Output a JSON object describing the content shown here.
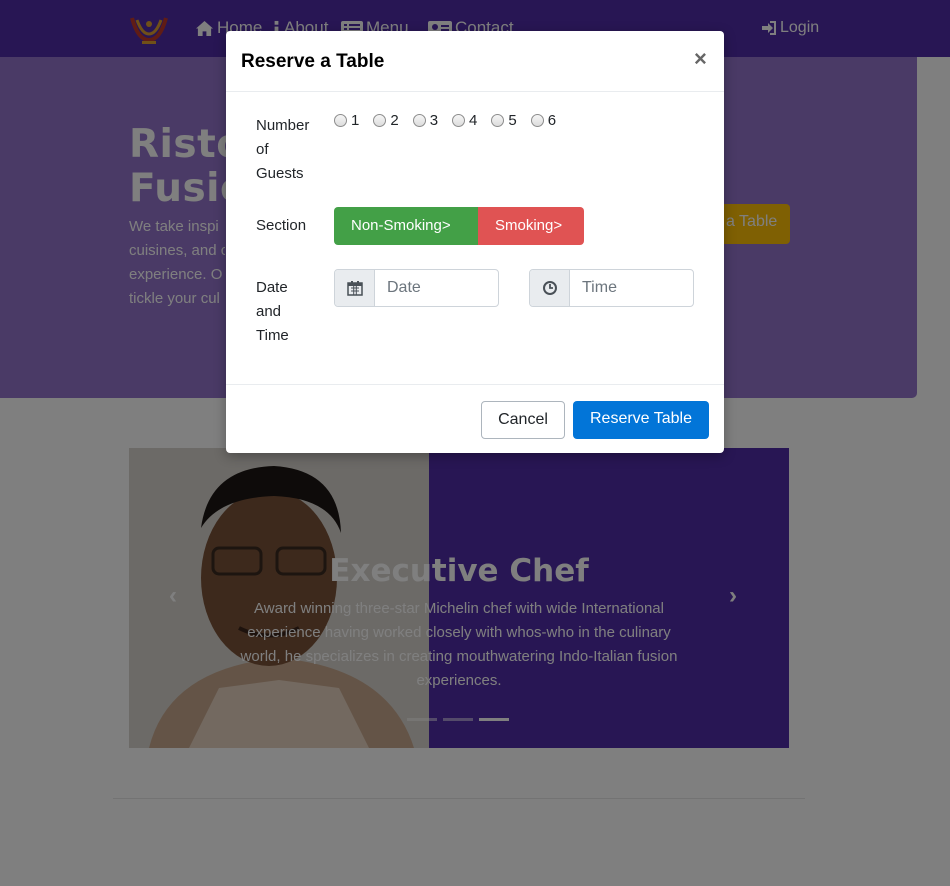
{
  "navbar": {
    "items": [
      {
        "label": "Home",
        "icon": "home-icon"
      },
      {
        "label": "About",
        "icon": "info-icon"
      },
      {
        "label": "Menu",
        "icon": "list-icon"
      },
      {
        "label": "Contact",
        "icon": "address-card-icon"
      }
    ],
    "login": {
      "label": "Login",
      "icon": "sign-in-icon"
    }
  },
  "jumbotron": {
    "title_line1": "Ristor",
    "title_line2": "Fusio",
    "lead_lines": [
      "We take inspi",
      "cuisines, and c",
      "experience. O",
      "tickle your cul"
    ],
    "button_label": "a Table"
  },
  "carousel": {
    "title": "Executive Chef",
    "text": "Award winning three-star Michelin chef with wide International experience having worked closely with whos-who in the culinary world, he specializes in creating mouthwatering Indo-Italian fusion experiences.",
    "prev_symbol": "‹",
    "next_symbol": "›"
  },
  "modal": {
    "title": "Reserve a Table",
    "close": "×",
    "guests_label": "Number of Guests",
    "guest_options": [
      "1",
      "2",
      "3",
      "4",
      "5",
      "6"
    ],
    "section_label": "Section",
    "section_options": [
      "Non-Smoking>",
      "Smoking>"
    ],
    "datetime_label": "Date and Time",
    "date_placeholder": "Date",
    "time_placeholder": "Time",
    "cancel_label": "Cancel",
    "submit_label": "Reserve Table"
  },
  "colors": {
    "primary": "#512da8",
    "light_primary": "#9575cd",
    "accent": "#ffc107",
    "success": "#43a047",
    "danger": "#e05353",
    "button_primary": "#0275d8"
  }
}
